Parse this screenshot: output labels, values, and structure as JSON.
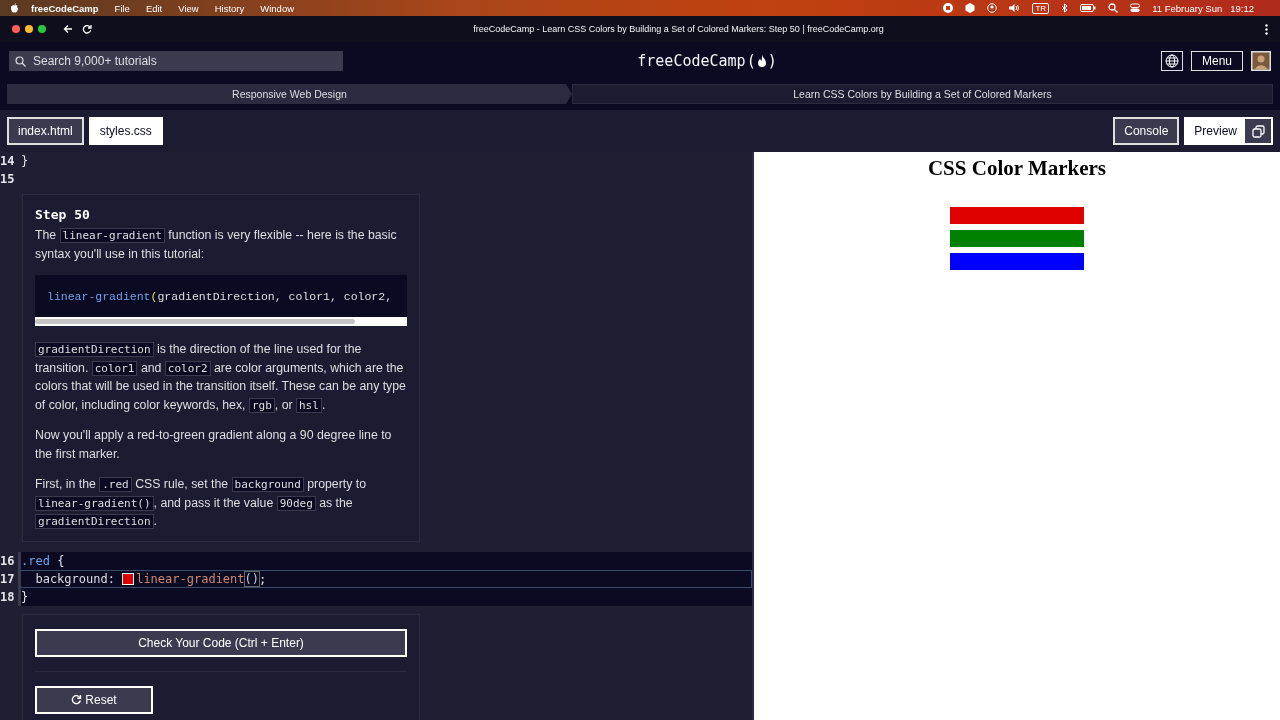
{
  "menubar": {
    "app": "freeCodeCamp",
    "menus": [
      "File",
      "Edit",
      "View",
      "History",
      "Window"
    ],
    "keyboard": "TR",
    "date": "11 February Sun",
    "time": "19:12"
  },
  "browser": {
    "title": "freeCodeCamp - Learn CSS Colors by Building a Set of Colored Markers: Step 50 | freeCodeCamp.org"
  },
  "nav": {
    "search": {
      "placeholder": "Search 9,000+ tutorials"
    },
    "logo": {
      "text": "freeCodeCamp",
      "open": "(",
      "close": ")"
    },
    "menu_button": "Menu"
  },
  "breadcrumbs": [
    {
      "label": "Responsive Web Design",
      "kind": "superblock"
    },
    {
      "label": "Learn CSS Colors by Building a Set of Colored Markers",
      "kind": "block"
    }
  ],
  "file_tabs": [
    {
      "label": "index.html",
      "selected": false
    },
    {
      "label": "styles.css",
      "selected": true
    }
  ],
  "pane_tabs": [
    {
      "label": "Console",
      "selected": false
    },
    {
      "label": "Preview",
      "selected": true
    }
  ],
  "editor": {
    "lines_before": [
      {
        "number": "14",
        "tokens": [
          {
            "text": "}",
            "kind": "punct"
          }
        ],
        "active": false
      },
      {
        "number": "15",
        "active": false
      }
    ],
    "instructions": {
      "title": "Step 50",
      "blocks": [
        {
          "kind": "text",
          "segments": [
            {
              "text": "The ",
              "kind": "plain"
            },
            {
              "text": "linear-gradient",
              "kind": "code"
            },
            {
              "text": " function is very flexible -- here is the basic syntax you'll use in this tutorial:",
              "kind": "plain"
            }
          ]
        },
        {
          "kind": "example",
          "func": "linear-gradient",
          "paren": "(",
          "args": "gradientDirection, color1, color2,"
        },
        {
          "kind": "text",
          "segments": [
            {
              "text": "gradientDirection",
              "kind": "code"
            },
            {
              "text": " is the direction of the line used for the transition. ",
              "kind": "plain"
            },
            {
              "text": "color1",
              "kind": "code"
            },
            {
              "text": " and ",
              "kind": "plain"
            },
            {
              "text": "color2",
              "kind": "code"
            },
            {
              "text": " are color arguments, which are the colors that will be used in the transition itself. These can be any type of color, including color keywords, hex, ",
              "kind": "plain"
            },
            {
              "text": "rgb",
              "kind": "code"
            },
            {
              "text": ", or ",
              "kind": "plain"
            },
            {
              "text": "hsl",
              "kind": "code"
            },
            {
              "text": ".",
              "kind": "plain"
            }
          ]
        },
        {
          "kind": "text",
          "segments": [
            {
              "text": "Now you'll apply a red-to-green gradient along a 90 degree line to the first marker.",
              "kind": "plain"
            }
          ]
        },
        {
          "kind": "text",
          "segments": [
            {
              "text": "First, in the ",
              "kind": "plain"
            },
            {
              "text": ".red",
              "kind": "code"
            },
            {
              "text": " CSS rule, set the ",
              "kind": "plain"
            },
            {
              "text": "background",
              "kind": "code"
            },
            {
              "text": " property to ",
              "kind": "plain"
            },
            {
              "text": "linear-gradient()",
              "kind": "code"
            },
            {
              "text": ", and pass it the value ",
              "kind": "plain"
            },
            {
              "text": "90deg",
              "kind": "code"
            },
            {
              "text": " as the ",
              "kind": "plain"
            },
            {
              "text": "gradientDirection",
              "kind": "code"
            },
            {
              "text": ".",
              "kind": "plain"
            }
          ]
        }
      ]
    },
    "lines_after": [
      {
        "number": "16",
        "tokens": [
          {
            "text": ".red",
            "kind": "selector"
          },
          {
            "text": " {",
            "kind": "punct"
          }
        ],
        "active": false
      },
      {
        "number": "17",
        "tokens": [
          {
            "text": "  background: ",
            "kind": "property"
          },
          {
            "kind": "swatch",
            "color": "#e00000"
          },
          {
            "text": "linear-gradient",
            "kind": "function"
          },
          {
            "text": "()",
            "kind": "bracket"
          },
          {
            "text": ";",
            "kind": "punct"
          }
        ],
        "active": true
      },
      {
        "number": "18",
        "tokens": [
          {
            "text": "}",
            "kind": "punct"
          }
        ],
        "active": false
      }
    ],
    "actions": {
      "check": "Check Your Code (Ctrl + Enter)",
      "reset": "Reset"
    }
  },
  "preview": {
    "title": "CSS Color Markers",
    "markers": [
      {
        "color": "#e00000"
      },
      {
        "color": "#008000"
      },
      {
        "color": "#0000ff"
      }
    ]
  }
}
